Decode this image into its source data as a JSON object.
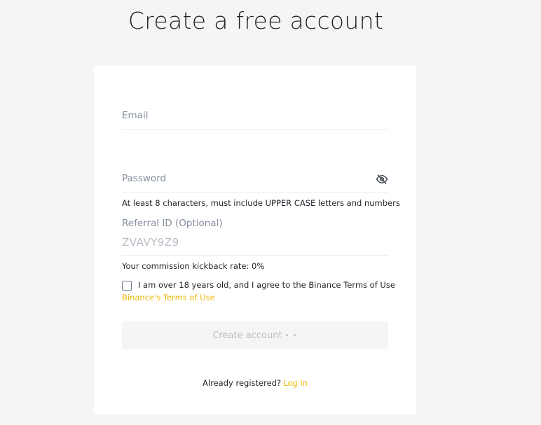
{
  "page": {
    "title": "Create a free account"
  },
  "form": {
    "email": {
      "label": "Email",
      "value": ""
    },
    "password": {
      "label": "Password",
      "value": "",
      "toggle_icon": "eye-off-icon",
      "hint": "At least 8 characters, must include UPPER CASE letters and numbers"
    },
    "referral": {
      "label": "Referral ID (Optional)",
      "value": "ZVAVY9Z9"
    },
    "kickback_text": "Your commission kickback rate: 0%",
    "agree": {
      "checked": false,
      "text": "I am over 18 years old, and I agree to the Binance Terms of Use",
      "terms_link": "Binance's Terms of Use"
    },
    "submit_label": "Create account",
    "submit_dots": "• •",
    "login_prompt": "Already registered?",
    "login_link": "Log In"
  },
  "colors": {
    "accent": "#f0b90b",
    "background": "#f5f5f5",
    "card": "#ffffff",
    "muted_text": "#848e9c",
    "disabled_text": "#b7bdc6"
  }
}
